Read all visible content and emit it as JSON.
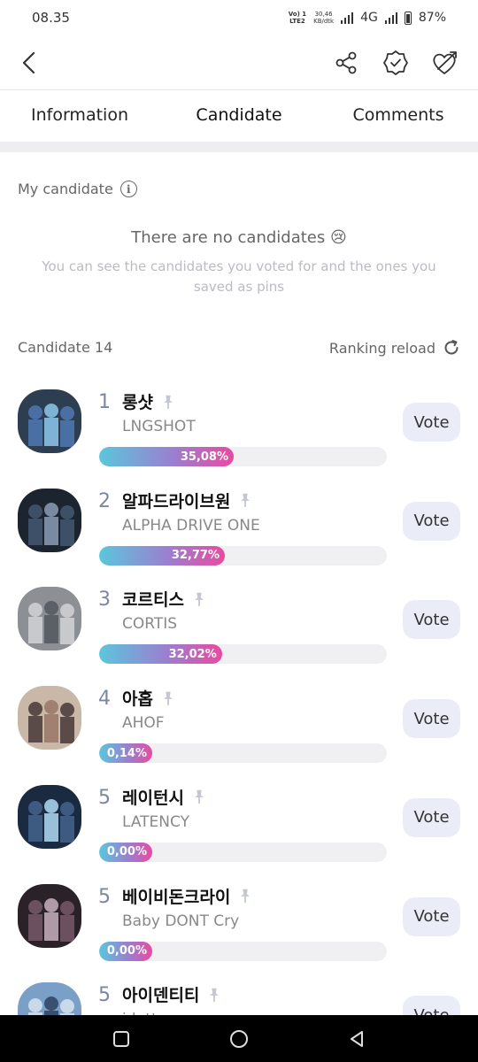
{
  "status_bar": {
    "time": "08.35",
    "volte_top": "Vo) 1",
    "volte_bottom": "LTE2",
    "speed_top": "30,46",
    "speed_bottom": "KB/dtk",
    "network": "4G",
    "battery": "87%"
  },
  "header": {
    "icons": [
      "back-icon",
      "share-icon",
      "verified-badge-icon",
      "heart-arrow-icon"
    ]
  },
  "tabs": [
    {
      "label": "Information",
      "active": false
    },
    {
      "label": "Candidate",
      "active": true
    },
    {
      "label": "Comments",
      "active": false
    }
  ],
  "my_candidate": {
    "label": "My candidate",
    "info_glyph": "i",
    "empty_title": "There are no candidates 😢",
    "empty_desc": "You can see the candidates you voted for and the ones you saved as pins"
  },
  "list": {
    "count_label": "Candidate 14",
    "reload_label": "Ranking reload"
  },
  "candidates": [
    {
      "rank": "1",
      "name_ko": "롱샷",
      "name_en": "LNGSHOT",
      "percent_label": "35,08%",
      "percent": 35.08,
      "vote_label": "Vote"
    },
    {
      "rank": "2",
      "name_ko": "알파드라이브원",
      "name_en": "ALPHA DRIVE ONE",
      "percent_label": "32,77%",
      "percent": 32.77,
      "vote_label": "Vote"
    },
    {
      "rank": "3",
      "name_ko": "코르티스",
      "name_en": "CORTIS",
      "percent_label": "32,02%",
      "percent": 32.02,
      "vote_label": "Vote"
    },
    {
      "rank": "4",
      "name_ko": "아홉",
      "name_en": "AHOF",
      "percent_label": "0,14%",
      "percent": 0.14,
      "vote_label": "Vote"
    },
    {
      "rank": "5",
      "name_ko": "레이턴시",
      "name_en": "LATENCY",
      "percent_label": "0,00%",
      "percent": 0.0,
      "vote_label": "Vote"
    },
    {
      "rank": "5",
      "name_ko": "베이비돈크라이",
      "name_en": "Baby DONT Cry",
      "percent_label": "0,00%",
      "percent": 0.0,
      "vote_label": "Vote"
    },
    {
      "rank": "5",
      "name_ko": "아이덴티티",
      "name_en": "idntt",
      "percent_label": "",
      "percent": 0.0,
      "vote_label": "Vote"
    }
  ],
  "colors": {
    "bar_start": "#5bc6dc",
    "bar_end": "#e94aa0",
    "vote_bg": "#eaedf8",
    "rank": "#7b86a4"
  },
  "nav_icons": [
    "recent-apps-icon",
    "home-icon",
    "back-nav-icon"
  ]
}
